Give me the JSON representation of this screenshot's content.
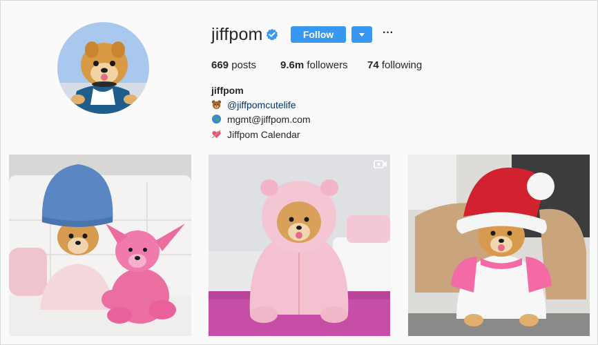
{
  "profile": {
    "username": "jiffpom",
    "follow_label": "Follow",
    "more_label": "···",
    "stats": {
      "posts_count": "669",
      "posts_label": "posts",
      "followers_count": "9.6m",
      "followers_label": "followers",
      "following_count": "74",
      "following_label": "following"
    },
    "full_name": "jiffpom",
    "bio": {
      "line1": "@jiffpomcutelife",
      "line2": "mgmt@jiffpom.com",
      "line3": "Jiffpom Calendar"
    }
  },
  "icons": {
    "verified": "verified-badge-icon",
    "dropdown": "caret-down-icon",
    "bear": "bear-emoji-icon",
    "globe": "globe-emoji-icon",
    "heart": "heart-arrow-emoji-icon",
    "video": "video-camera-icon"
  },
  "colors": {
    "accent": "#3897f0",
    "link": "#003569",
    "background": "#fafafa"
  }
}
